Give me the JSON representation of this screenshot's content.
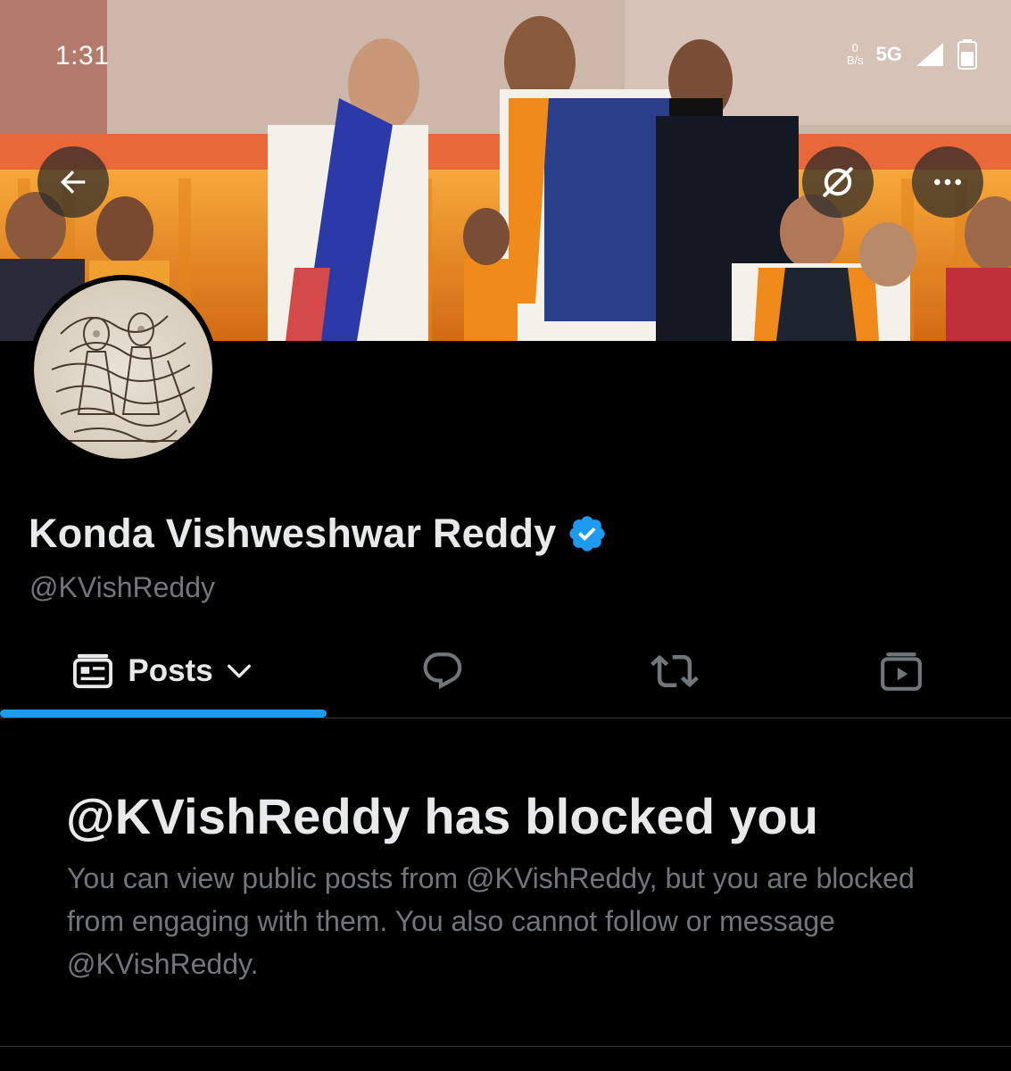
{
  "status_bar": {
    "time": "1:31",
    "speed_value": "0",
    "speed_unit": "B/s",
    "network": "5G"
  },
  "header": {
    "back_icon": "arrow-left-icon",
    "grok_icon": "grok-slash-icon",
    "more_icon": "more-dots-icon"
  },
  "profile": {
    "name": "Konda Vishweshwar Reddy",
    "handle": "@KVishReddy",
    "verified_color": "#1d9bf0"
  },
  "tabs": {
    "posts_label": "Posts",
    "posts_icon": "post-card-icon",
    "replies_icon": "reply-bubble-icon",
    "reposts_icon": "repost-icon",
    "media_icon": "video-icon"
  },
  "blocked": {
    "title": "@KVishReddy has blocked you",
    "description": "You can view public posts from @KVishReddy, but you are blocked from engaging with them. You also cannot follow or message @KVishReddy."
  },
  "colors": {
    "accent": "#1d9bf0",
    "background": "#000000",
    "text_primary": "#e7e9ea",
    "text_secondary": "#71767b"
  }
}
